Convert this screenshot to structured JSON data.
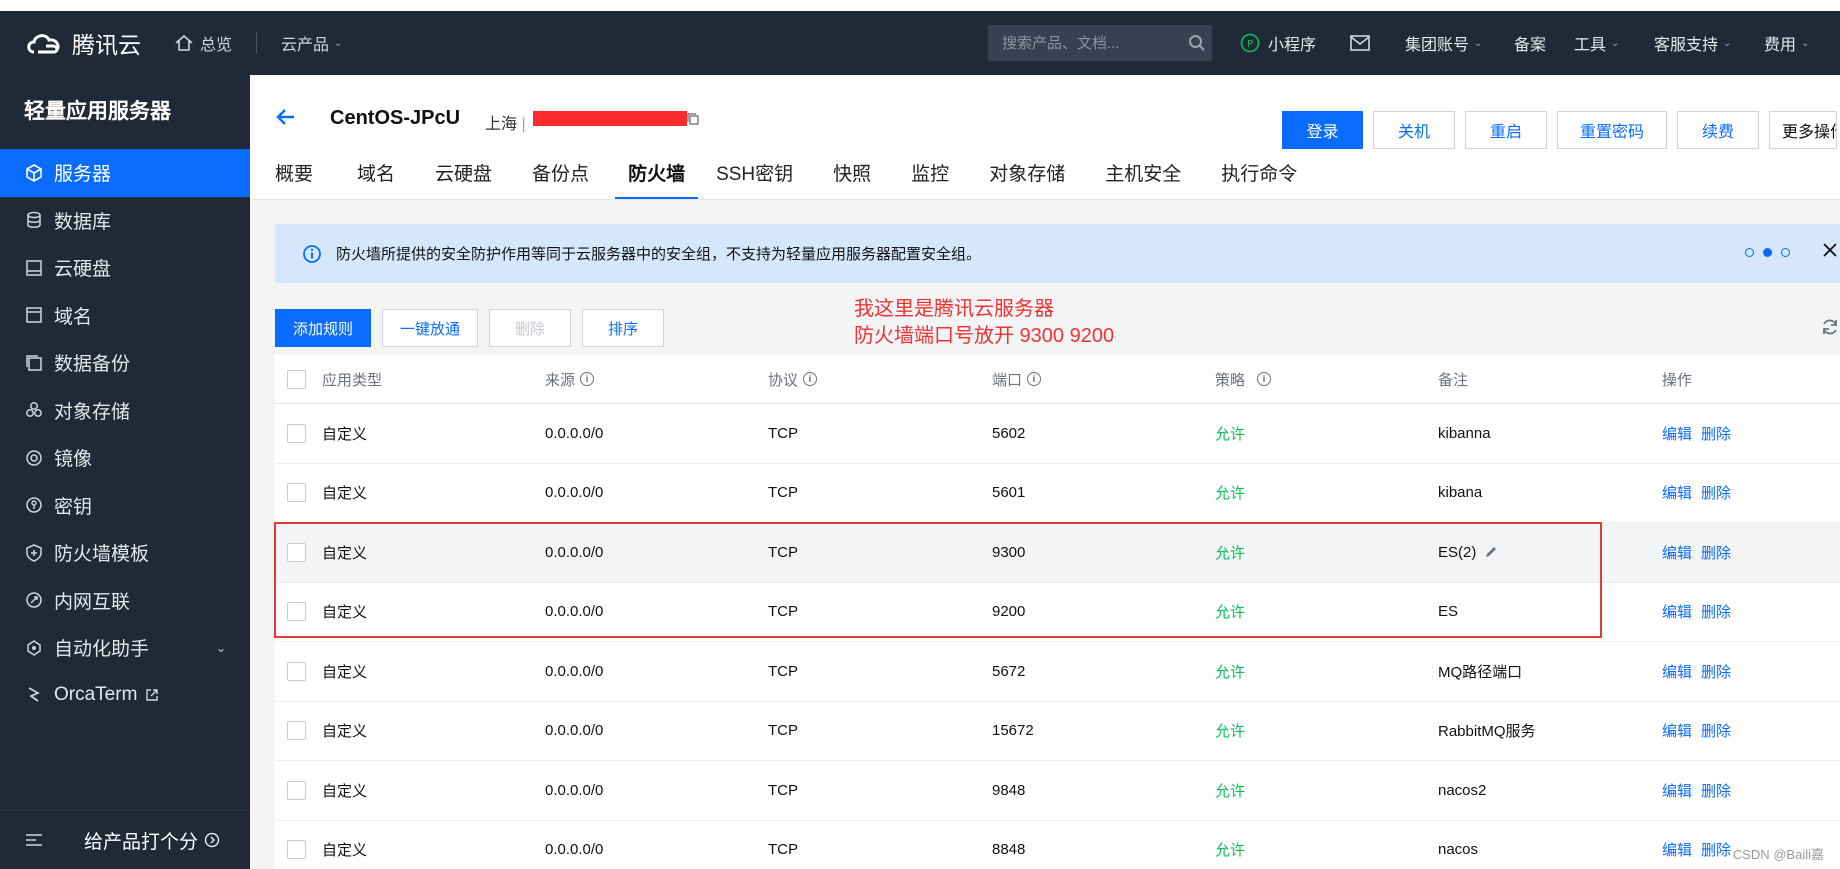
{
  "topnav": {
    "logo_text": "腾讯云",
    "overview": "总览",
    "products": "云产品",
    "search_placeholder": "搜索产品、文档...",
    "mini_program": "小程序",
    "group_account": "集团账号",
    "icp": "备案",
    "tools": "工具",
    "support": "客服支持",
    "billing": "费用"
  },
  "sidebar": {
    "title": "轻量应用服务器",
    "items": [
      {
        "label": "服务器",
        "icon": "cube-icon"
      },
      {
        "label": "数据库",
        "icon": "database-icon"
      },
      {
        "label": "云硬盘",
        "icon": "disk-icon"
      },
      {
        "label": "域名",
        "icon": "domain-icon"
      },
      {
        "label": "数据备份",
        "icon": "backup-icon"
      },
      {
        "label": "对象存储",
        "icon": "storage-icon"
      },
      {
        "label": "镜像",
        "icon": "image-icon"
      },
      {
        "label": "密钥",
        "icon": "key-icon"
      },
      {
        "label": "防火墙模板",
        "icon": "shield-icon"
      },
      {
        "label": "内网互联",
        "icon": "network-icon"
      },
      {
        "label": "自动化助手",
        "icon": "robot-icon"
      },
      {
        "label": "OrcaTerm",
        "icon": "terminal-icon"
      }
    ],
    "feedback": "给产品打个分"
  },
  "header": {
    "instance_name": "CentOS-JPcU",
    "region": "上海",
    "buttons": {
      "login": "登录",
      "shutdown": "关机",
      "restart": "重启",
      "reset_password": "重置密码",
      "renew": "续费",
      "more": "更多操作"
    },
    "tabs": [
      "概要",
      "域名",
      "云硬盘",
      "备份点",
      "防火墙",
      "SSH密钥",
      "快照",
      "监控",
      "对象存储",
      "主机安全",
      "执行命令"
    ],
    "active_tab": "防火墙"
  },
  "notice": {
    "text": "防火墙所提供的安全防护作用等同于云服务器中的安全组，不支持为轻量应用服务器配置安全组。"
  },
  "toolbar": {
    "add_rule": "添加规则",
    "one_click": "一键放通",
    "delete": "删除",
    "sort": "排序"
  },
  "annotation": {
    "line1": "我这里是腾讯云服务器",
    "line2": "防火墙端口号放开 9300 9200"
  },
  "table": {
    "headers": {
      "app_type": "应用类型",
      "source": "来源",
      "protocol": "协议",
      "port": "端口",
      "policy": "策略",
      "remark": "备注",
      "action": "操作"
    },
    "edit": "编辑",
    "delete": "删除",
    "rows": [
      {
        "app_type": "自定义",
        "source": "0.0.0.0/0",
        "protocol": "TCP",
        "port": "5602",
        "policy": "允许",
        "remark": "kibanna"
      },
      {
        "app_type": "自定义",
        "source": "0.0.0.0/0",
        "protocol": "TCP",
        "port": "5601",
        "policy": "允许",
        "remark": "kibana"
      },
      {
        "app_type": "自定义",
        "source": "0.0.0.0/0",
        "protocol": "TCP",
        "port": "9300",
        "policy": "允许",
        "remark": "ES(2)"
      },
      {
        "app_type": "自定义",
        "source": "0.0.0.0/0",
        "protocol": "TCP",
        "port": "9200",
        "policy": "允许",
        "remark": "ES"
      },
      {
        "app_type": "自定义",
        "source": "0.0.0.0/0",
        "protocol": "TCP",
        "port": "5672",
        "policy": "允许",
        "remark": "MQ路径端口"
      },
      {
        "app_type": "自定义",
        "source": "0.0.0.0/0",
        "protocol": "TCP",
        "port": "15672",
        "policy": "允许",
        "remark": "RabbitMQ服务"
      },
      {
        "app_type": "自定义",
        "source": "0.0.0.0/0",
        "protocol": "TCP",
        "port": "9848",
        "policy": "允许",
        "remark": "nacos2"
      },
      {
        "app_type": "自定义",
        "source": "0.0.0.0/0",
        "protocol": "TCP",
        "port": "8848",
        "policy": "允许",
        "remark": "nacos"
      }
    ]
  },
  "watermark": "CSDN @Baili嘉",
  "colors": {
    "accent": "#0a6cff",
    "nav_bg": "#1f2937",
    "allow": "#0abf5b",
    "annotation": "#f03232"
  }
}
